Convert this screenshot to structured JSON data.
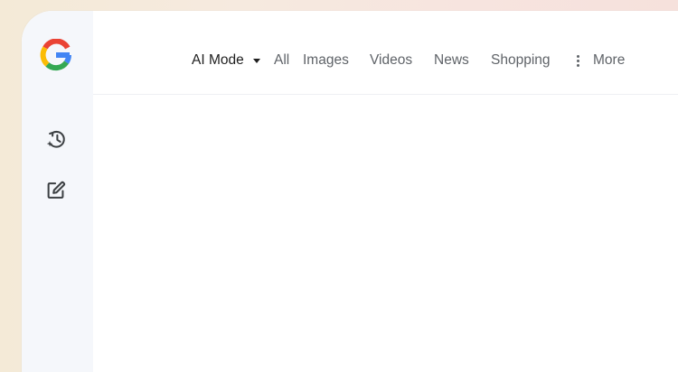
{
  "brand": {
    "logo_icon": "google-g-icon",
    "colors": {
      "blue": "#4285F4",
      "red": "#EA4335",
      "yellow": "#FBBC05",
      "green": "#34A853"
    }
  },
  "sidebar": {
    "items": [
      {
        "icon": "history-sparkle-icon"
      },
      {
        "icon": "edit-icon"
      }
    ]
  },
  "nav": {
    "active": "AI Mode",
    "tabs": [
      "All",
      "Images",
      "Videos",
      "News",
      "Shopping"
    ],
    "more": "More"
  }
}
